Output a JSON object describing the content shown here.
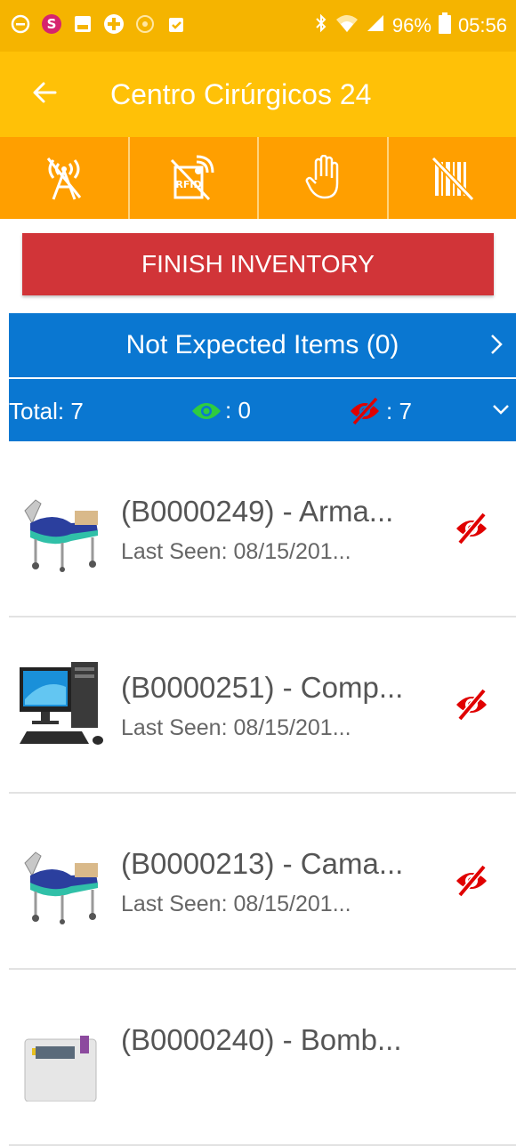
{
  "status_bar": {
    "battery": "96%",
    "time": "05:56",
    "left_icons": [
      "minus-circle-icon",
      "s-app-icon",
      "gallery-icon",
      "medical-app-icon",
      "camera-lens-icon",
      "clipboard-icon"
    ],
    "right_icons": [
      "bluetooth-icon",
      "wifi-icon",
      "signal-icon",
      "battery-icon"
    ]
  },
  "app_bar": {
    "title": "Centro Cirúrgicos 24"
  },
  "toolbar": {
    "tools": [
      "antenna-off-icon",
      "rfid-off-icon",
      "hand-icon",
      "barcode-off-icon"
    ]
  },
  "finish_label": "FINISH INVENTORY",
  "not_expected_label": "Not Expected Items (0)",
  "totals": {
    "total_label": "Total: 7",
    "seen_count": ": 0",
    "unseen_count": ": 7"
  },
  "items": [
    {
      "name": "(B0000249) - Arma...",
      "last_seen": "Last Seen:  08/15/201...",
      "thumb": "hospital-bed-icon"
    },
    {
      "name": "(B0000251) - Comp...",
      "last_seen": "Last Seen:  08/15/201...",
      "thumb": "computer-icon"
    },
    {
      "name": "(B0000213) - Cama...",
      "last_seen": "Last Seen:  08/15/201...",
      "thumb": "hospital-bed-icon"
    },
    {
      "name": "(B0000240) - Bomb...",
      "last_seen": "",
      "thumb": "infusion-pump-icon"
    }
  ],
  "colors": {
    "status_bar": "#f5b400",
    "app_bar": "#ffc107",
    "toolbar": "#ff9f00",
    "finish": "#d13438",
    "blue": "#0a77d1",
    "seen": "#2ecc40",
    "unseen": "#e00000"
  }
}
